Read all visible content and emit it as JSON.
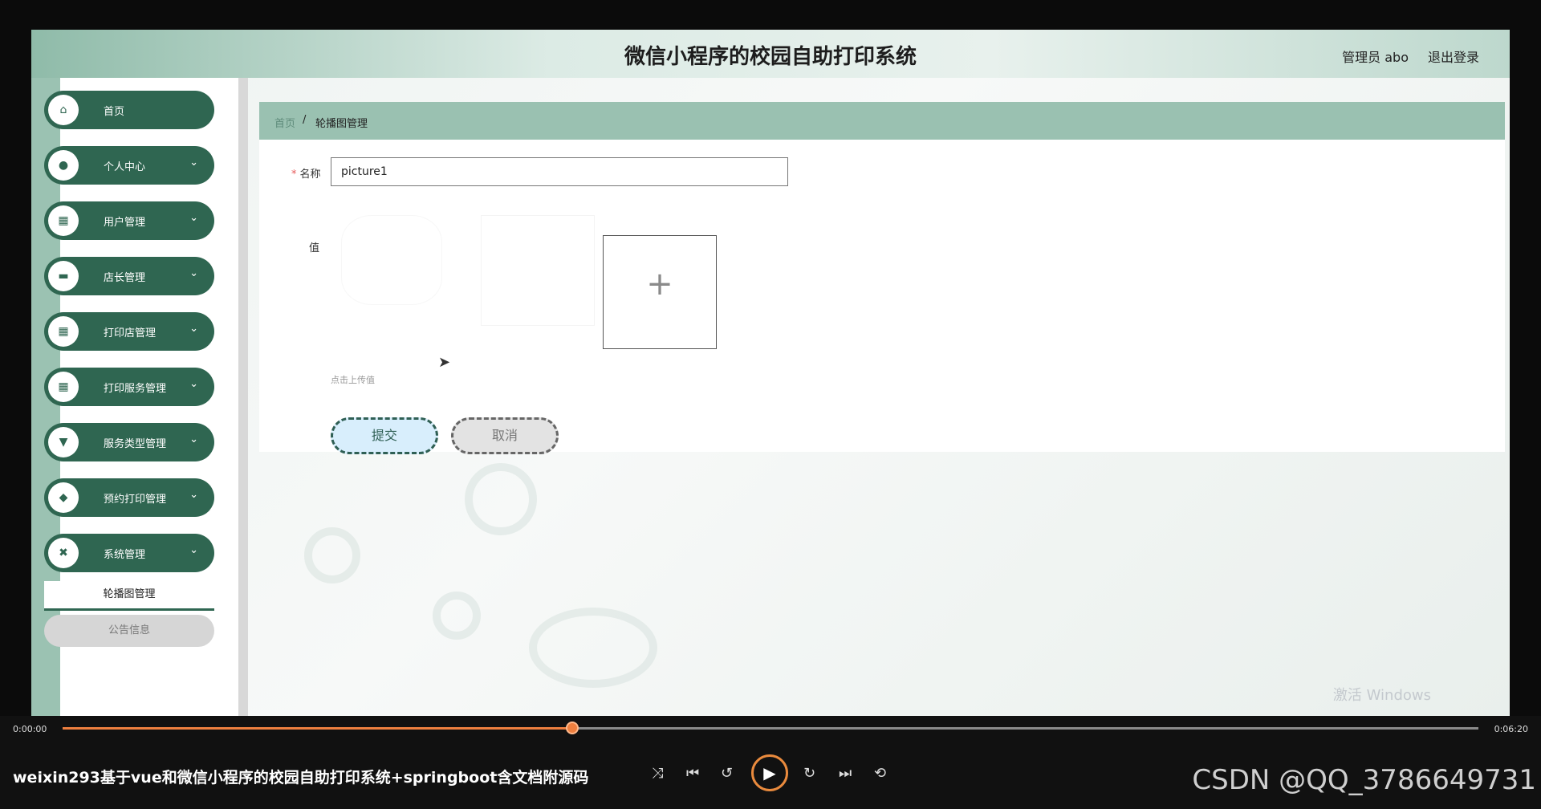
{
  "header": {
    "title": "微信小程序的校园自助打印系统",
    "admin": "管理员 abo",
    "logout": "退出登录"
  },
  "sidebar": {
    "items": [
      {
        "label": "首页",
        "icon": "⌂",
        "chevron": ""
      },
      {
        "label": "个人中心",
        "icon": "●",
        "chevron": "⌄"
      },
      {
        "label": "用户管理",
        "icon": "▦",
        "chevron": "⌄"
      },
      {
        "label": "店长管理",
        "icon": "▬",
        "chevron": "⌄"
      },
      {
        "label": "打印店管理",
        "icon": "▦",
        "chevron": "⌄"
      },
      {
        "label": "打印服务管理",
        "icon": "▦",
        "chevron": "⌄"
      },
      {
        "label": "服务类型管理",
        "icon": "▼",
        "chevron": "⌄"
      },
      {
        "label": "预约打印管理",
        "icon": "◆",
        "chevron": "⌄"
      },
      {
        "label": "系统管理",
        "icon": "✖",
        "chevron": "⌄"
      }
    ],
    "submenu": {
      "active": "轮播图管理",
      "other": "公告信息"
    }
  },
  "breadcrumb": {
    "home": "首页",
    "separator": "/",
    "current": "轮播图管理"
  },
  "form": {
    "name_label": "名称",
    "name_value": "picture1",
    "value_label": "值",
    "upload_plus": "+",
    "hint": "点击上传值",
    "submit": "提交",
    "cancel": "取消"
  },
  "watermark": "激活 Windows",
  "player": {
    "time_current": "0:00:00",
    "time_total": "0:06:20",
    "progress": 0.36,
    "title": "weixin293基于vue和微信小程序的校园自助打印系统+springboot含文档附源码",
    "controls": {
      "shuffle": "⤨",
      "prev": "⏮",
      "back10": "↺",
      "play": "▶",
      "fwd30": "↻",
      "next": "⏭",
      "loop": "⟲"
    },
    "brand": "CSDN @QQ_3786649731"
  },
  "colors": {
    "sidebar_green": "#2f6651",
    "breadcrumb_bg": "#9ac1b1",
    "progress": "#ee7f3f"
  }
}
